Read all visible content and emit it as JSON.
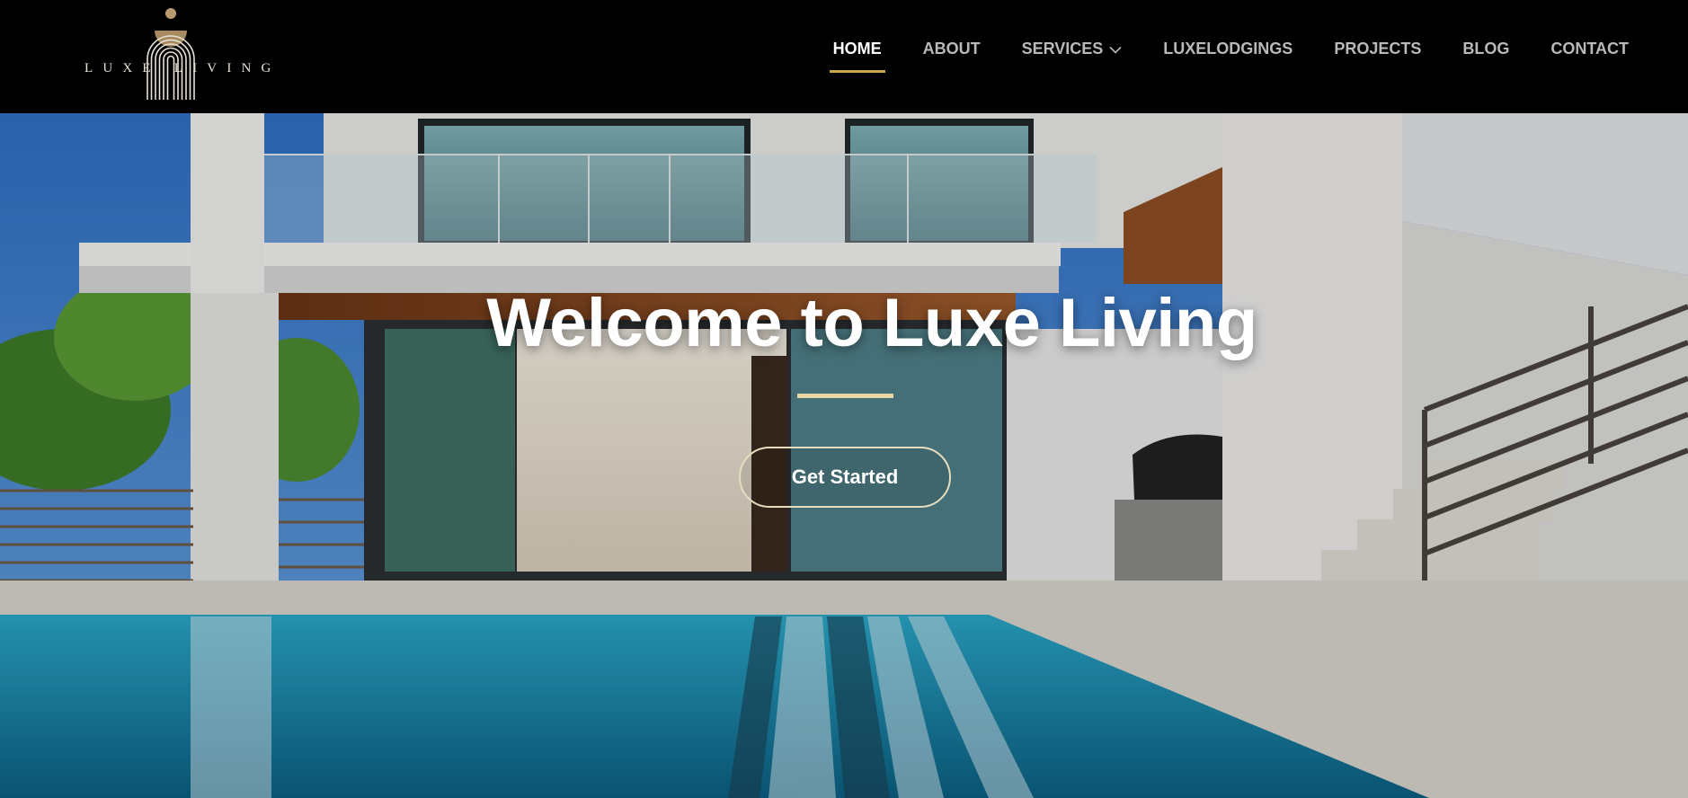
{
  "brand": {
    "logo_text": "LUXE LIVING",
    "colors": {
      "accent": "#c9a646",
      "nav_bg": "#000000",
      "nav_text": "#b9b9b9",
      "nav_active": "#ffffff"
    }
  },
  "nav": {
    "items": [
      {
        "label": "HOME",
        "active": true
      },
      {
        "label": "ABOUT"
      },
      {
        "label": "SERVICES",
        "icon": "chevron-down-icon"
      },
      {
        "label": "LUXELODGINGS"
      },
      {
        "label": "PROJECTS"
      },
      {
        "label": "BLOG"
      },
      {
        "label": "CONTACT"
      }
    ]
  },
  "hero": {
    "title": "Welcome to Luxe Living",
    "cta_label": "Get Started"
  }
}
